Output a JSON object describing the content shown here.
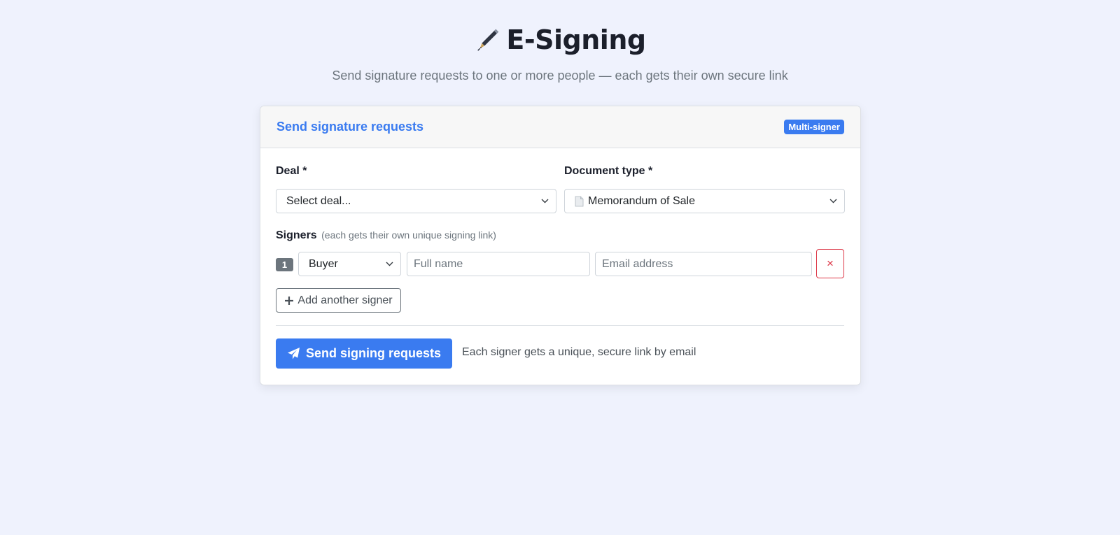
{
  "header": {
    "title_icon": "pen-icon",
    "title": "E-Signing",
    "subtitle": "Send signature requests to one or more people — each gets their own secure link"
  },
  "card": {
    "title": "Send signature requests",
    "badge": "Multi-signer",
    "deal": {
      "label": "Deal *",
      "value": "Select deal..."
    },
    "document_type": {
      "label": "Document type *",
      "icon": "document-icon",
      "value": "Memorandum of Sale"
    },
    "signers": {
      "label": "Signers",
      "hint": "(each gets their own unique signing link)",
      "rows": [
        {
          "number": "1",
          "role": "Buyer",
          "name_placeholder": "Full name",
          "email_placeholder": "Email address",
          "remove_label": "×"
        }
      ]
    },
    "add_signer_label": "Add another signer",
    "send_label": "Send signing requests",
    "send_note": "Each signer gets a unique, secure link by email"
  },
  "colors": {
    "accent": "#3a7bf0",
    "danger": "#dc3545",
    "background": "#eff2fd"
  }
}
